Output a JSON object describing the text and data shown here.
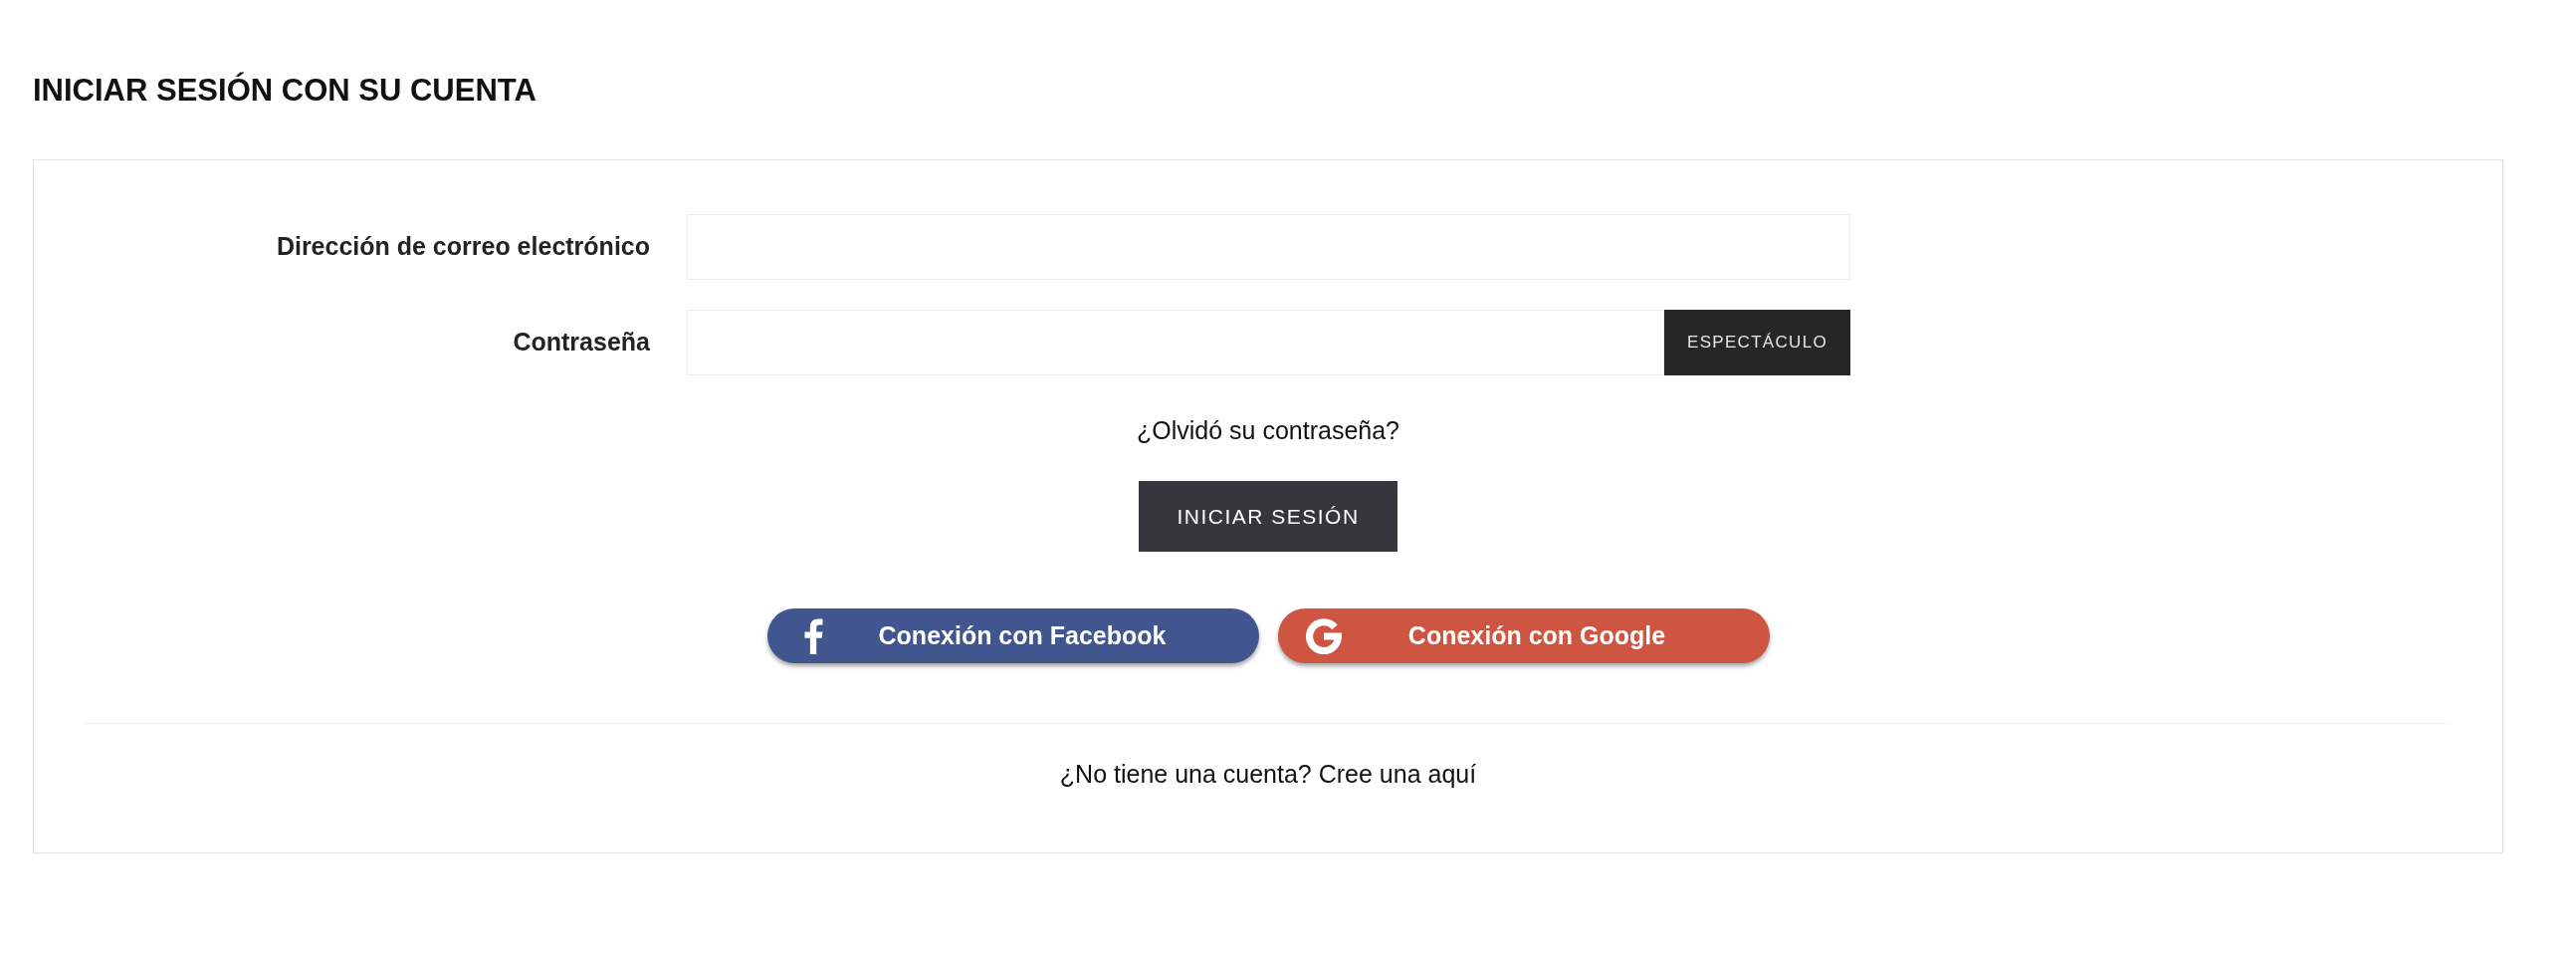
{
  "page_title": "INICIAR SESIÓN CON SU CUENTA",
  "form": {
    "fields": [
      {
        "label": "Dirección de correo electrónico"
      },
      {
        "label": "Contraseña",
        "button": "ESPECTÁCULO"
      }
    ],
    "forgot_link": "¿Olvidó su contraseña?",
    "submit_button": "INICIAR SESIÓN",
    "social_buttons": [
      {
        "kind": "facebook",
        "label": "Conexión con Facebook",
        "color": "#41568f"
      },
      {
        "kind": "google",
        "label": "Conexión con Google",
        "color": "#cd5542"
      }
    ],
    "signup": {
      "text": "¿No tiene una cuenta?",
      "link": "Cree una aquí"
    }
  }
}
